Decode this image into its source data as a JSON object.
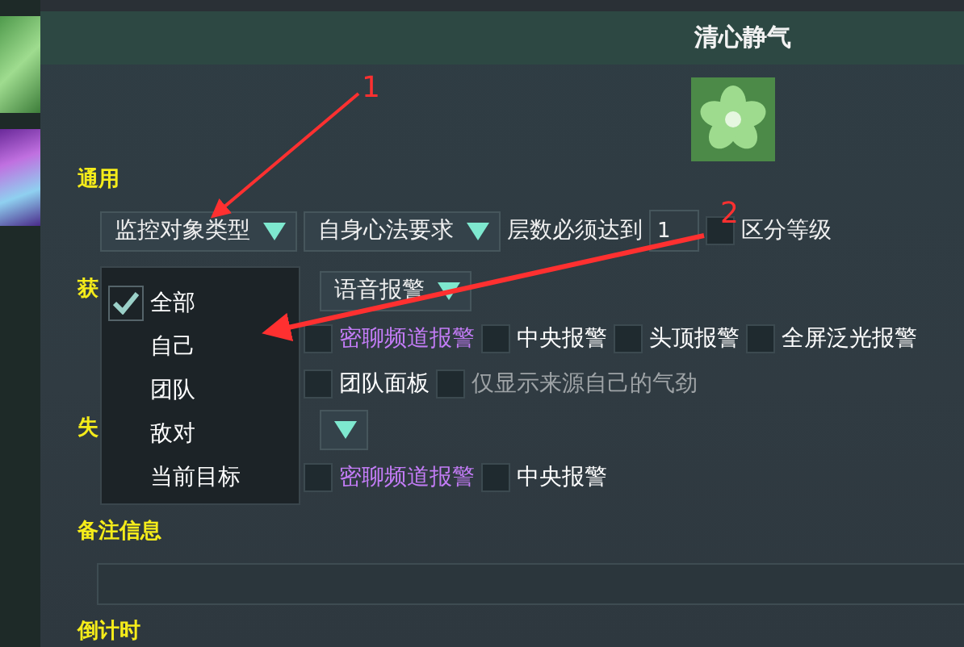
{
  "title": "清心静气",
  "general": {
    "label": "通用",
    "dropdowns": [
      {
        "label": "监控对象类型"
      },
      {
        "label": "自身心法要求"
      }
    ],
    "stack_label": "层数必须达到",
    "stack_value": "1",
    "grade_checkbox": {
      "label": "区分等级",
      "checked": false
    }
  },
  "gain": {
    "label": "获",
    "dropdowns": [
      {
        "kind": "labeled",
        "label": "语音报警"
      }
    ],
    "option_rows": [
      [
        {
          "label": "密聊频道报警",
          "checked": false,
          "color": "#c27cf5"
        },
        {
          "label": "中央报警",
          "checked": false,
          "color": "#ffffff"
        },
        {
          "label": "头顶报警",
          "checked": false,
          "color": "#ffffff"
        },
        {
          "label": "全屏泛光报警",
          "checked": false,
          "color": "#ffffff"
        }
      ],
      [
        {
          "label": "团队面板",
          "checked": false,
          "color": "#ffffff"
        },
        {
          "label": "仅显示来源自己的气劲",
          "checked": false,
          "color": "#9ea3a6"
        }
      ]
    ]
  },
  "lose": {
    "label": "失",
    "dropdowns": [
      {
        "kind": "caret"
      }
    ],
    "option_rows": [
      [
        {
          "label": "密聊频道报警",
          "checked": false,
          "color": "#c27cf5"
        },
        {
          "label": "中央报警",
          "checked": false,
          "color": "#ffffff"
        }
      ]
    ]
  },
  "note": {
    "label": "备注信息"
  },
  "countdown": {
    "label": "倒计时"
  },
  "menu": {
    "items": [
      {
        "label": "全部",
        "checked": true
      },
      {
        "label": "自己",
        "checked": false
      },
      {
        "label": "团队",
        "checked": false
      },
      {
        "label": "敌对",
        "checked": false
      },
      {
        "label": "当前目标",
        "checked": false
      }
    ]
  },
  "annotations": [
    {
      "label": "1"
    },
    {
      "label": "2"
    }
  ]
}
